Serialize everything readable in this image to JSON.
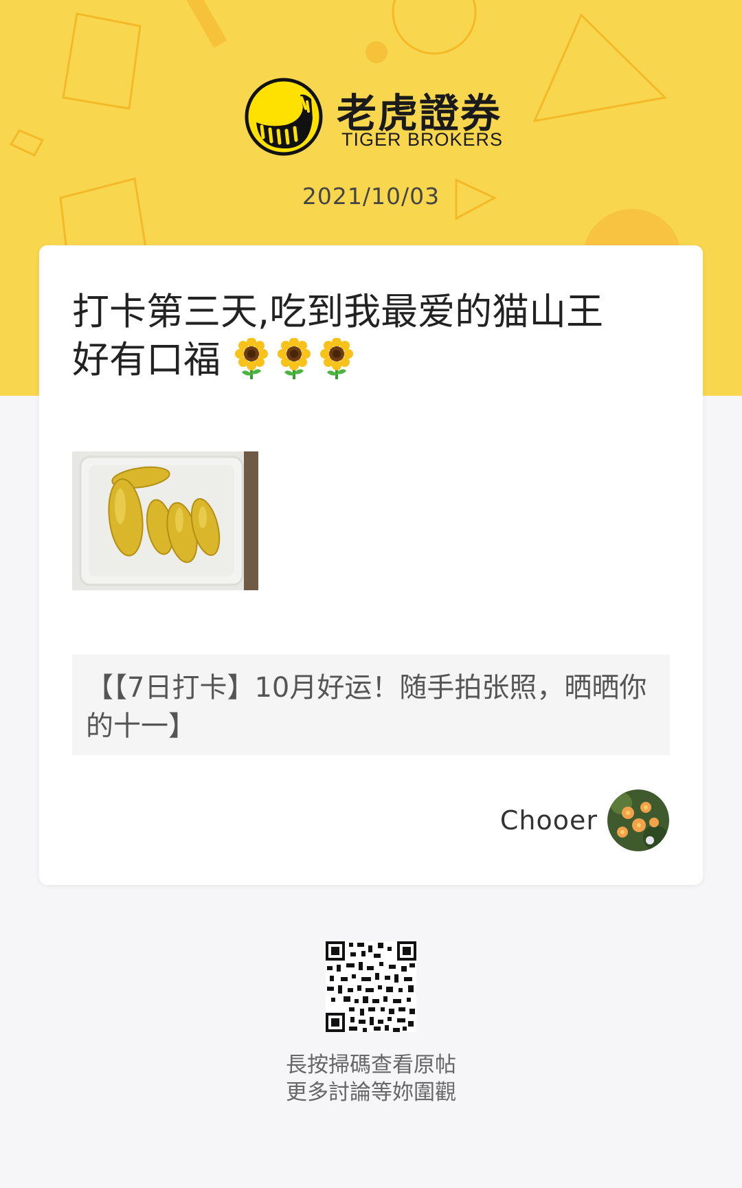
{
  "brand": {
    "name_cn": "老虎證券",
    "name_en": "TIGER BROKERS"
  },
  "date": "2021/10/03",
  "post": {
    "title_line1": "打卡第三天,吃到我最爱的猫山王",
    "title_line2": "好有口福",
    "title_emoji_count": 3,
    "topic": "【【7日打卡】10月好运！随手拍张照，晒晒你的十一】"
  },
  "author": {
    "name": "Chooer"
  },
  "footer": {
    "line1": "長按掃碼查看原帖",
    "line2": "更多討論等妳圍觀"
  },
  "colors": {
    "banner": "#f8d74f",
    "accent": "#ffe100",
    "page_bg": "#f6f6f8"
  },
  "icons": [
    "tiger-logo-icon",
    "sunflower-icon",
    "qr-code"
  ]
}
